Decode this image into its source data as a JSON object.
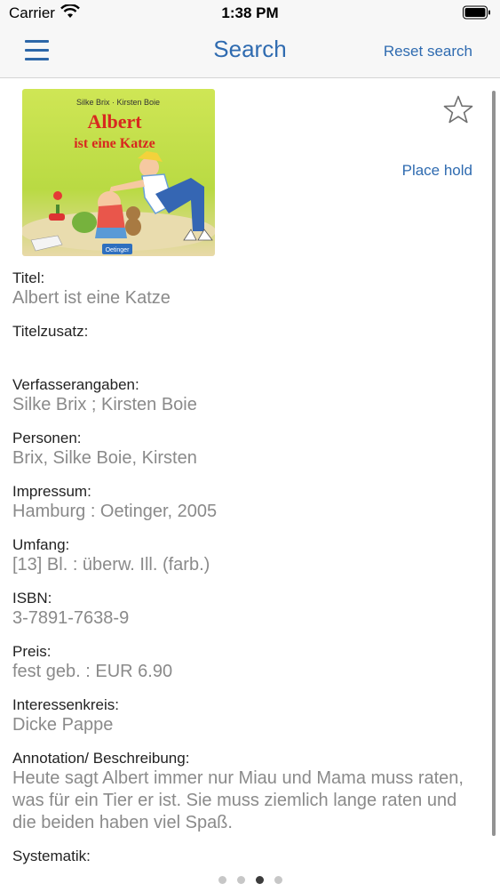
{
  "status_bar": {
    "carrier": "Carrier",
    "time": "1:38 PM"
  },
  "nav": {
    "title": "Search",
    "reset_label": "Reset search"
  },
  "actions": {
    "place_hold": "Place hold"
  },
  "cover_image": {
    "authors_text": "Silke Brix · Kirsten Boie",
    "title_line1": "Albert",
    "title_line2": "ist eine Katze",
    "publisher_badge": "Oetinger"
  },
  "fields": [
    {
      "label": "Titel:",
      "value": "Albert ist eine Katze"
    },
    {
      "label": "Titelzusatz:",
      "value": ""
    },
    {
      "label": "Verfasserangaben:",
      "value": "Silke Brix ; Kirsten Boie"
    },
    {
      "label": "Personen:",
      "value": "Brix, Silke Boie, Kirsten"
    },
    {
      "label": "Impressum:",
      "value": "Hamburg : Oetinger, 2005"
    },
    {
      "label": "Umfang:",
      "value": "[13] Bl. : überw. Ill. (farb.)"
    },
    {
      "label": "ISBN:",
      "value": "3-7891-7638-9"
    },
    {
      "label": "Preis:",
      "value": "fest geb. : EUR 6.90"
    },
    {
      "label": "Interessenkreis:",
      "value": "Dicke Pappe"
    },
    {
      "label": "Annotation/ Beschreibung:",
      "value": "Heute sagt Albert immer nur Miau und Mama muss raten, was für ein Tier er ist. Sie muss ziemlich lange raten und die beiden haben viel Spaß."
    },
    {
      "label": "Systematik:",
      "value": ""
    }
  ],
  "pager": {
    "count": 4,
    "active_index": 2
  },
  "colors": {
    "accent": "#2f6bb0",
    "label": "#222222",
    "value": "#8a8a8a",
    "bar_bg": "#f7f7f7"
  }
}
